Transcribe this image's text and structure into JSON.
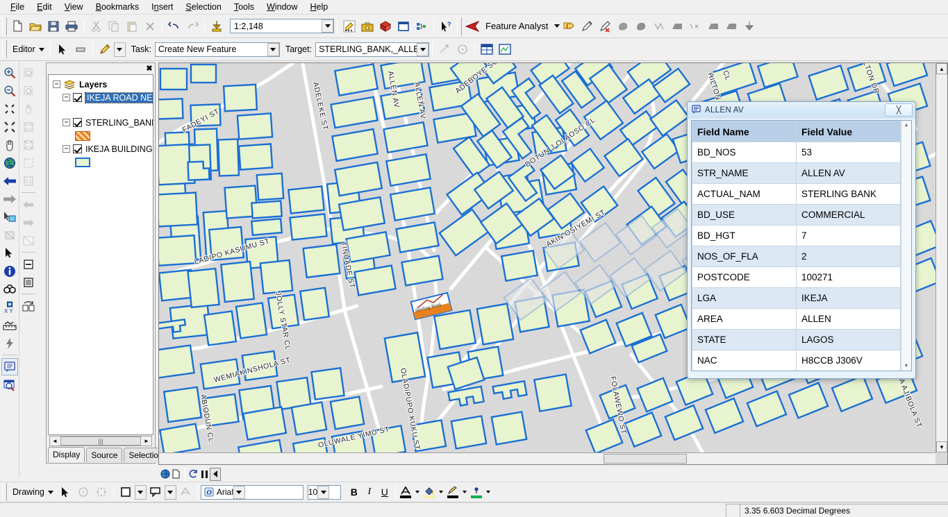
{
  "app": {
    "title": "ArcMap"
  },
  "menu": {
    "items": [
      "File",
      "Edit",
      "View",
      "Bookmarks",
      "Insert",
      "Selection",
      "Tools",
      "Window",
      "Help"
    ]
  },
  "standard_toolbar": {
    "scale": "1:2,148",
    "buttons": [
      "new-icon",
      "open-icon",
      "save-icon",
      "print-icon",
      "cut-icon",
      "copy-icon",
      "paste-icon",
      "delete-icon",
      "undo-icon",
      "redo-icon",
      "add-data-icon"
    ],
    "right_buttons": [
      "editor-toolbar-icon",
      "toolbox-icon",
      "model-builder-icon",
      "command-line-icon",
      "python-icon",
      "whats-this-icon"
    ]
  },
  "feature_analyst": {
    "label": "Feature Analyst",
    "buttons": [
      "learn-icon",
      "draw-icon",
      "erase-icon",
      "polygon-icon",
      "polygon2-icon",
      "vertex-icon",
      "clip-icon",
      "remove-icon",
      "merge-icon",
      "split-icon",
      "down-icon"
    ]
  },
  "editor_toolbar": {
    "editor_label": "Editor",
    "task_label": "Task:",
    "task_value": "Create New Feature",
    "target_label": "Target:",
    "target_value": "STERLING_BANK,_ALLEN_AV",
    "buttons": [
      "edit-tool-icon",
      "edit-sketch-icon",
      "sketch-tool-icon",
      "split-tool-icon",
      "rotate-icon",
      "attributes-icon",
      "sketch-properties-icon"
    ]
  },
  "tools_palette": {
    "col1": [
      "zoom-in-icon",
      "zoom-out-icon",
      "fixed-zoom-in-icon",
      "fixed-zoom-out-icon",
      "pan-icon",
      "full-extent-icon",
      "go-back-icon",
      "go-forward-icon",
      "select-features-icon",
      "clear-selection-icon",
      "select-elements-icon",
      "identify-icon",
      "find-icon",
      "go-to-xy-icon",
      "measure-icon",
      "flash-icon",
      "html-popup-icon",
      "hyperlink-icon"
    ],
    "col2": [
      "zoom-in-layout-icon",
      "zoom-out-layout-icon",
      "pan-layout-icon",
      "fixed-zoom-in-layout-icon",
      "fixed-zoom-out-layout-icon",
      "full-page-icon",
      "one-to-one-icon",
      "back-layout-icon",
      "forward-layout-icon",
      "toggle-draft-icon",
      "focus-data-frame-icon",
      "change-layout-icon",
      "page-rotate-icon"
    ]
  },
  "toc": {
    "close_label": "✖",
    "root": "Layers",
    "layers": [
      {
        "name": "IKEJA ROAD NET",
        "selected": true,
        "checked": true,
        "symbol": null
      },
      {
        "name": "STERLING_BANK,",
        "selected": false,
        "checked": true,
        "symbol": "orange"
      },
      {
        "name": "IKEJA BUILDING F",
        "selected": false,
        "checked": true,
        "symbol": "green"
      }
    ],
    "tabs": [
      {
        "label": "Display",
        "active": true
      },
      {
        "label": "Source",
        "active": false
      },
      {
        "label": "Selection",
        "active": false
      }
    ]
  },
  "map": {
    "background_color": "#d9d9d9",
    "building_fill": "#e7f4cf",
    "building_stroke": "#1a6fd4",
    "road_color": "#ffffff",
    "selected_feature_label": "Sterling Bank",
    "street_labels": [
      "FADEYI ST",
      "ADELEKE ST",
      "LADIPO KASUMU ST",
      "ALLEN AV",
      "ALLEN AV",
      "ADEBOYE SOLANKE AV",
      "DOTUN J OLAOSO CL",
      "AKIN OSIYEMI ST",
      "TINUADE ST",
      "JOLLY STAR CL",
      "WEMIAKINSHOLA ST",
      "ABIODUN CL",
      "OLUWALE YIMU ST",
      "OLADIPUPO KUKU ST",
      "FOLAWEWO ST",
      "OLA AJIBOLA ST",
      "HILTON DR",
      "OR CL"
    ]
  },
  "map_nav": {
    "buttons": [
      "globe-icon",
      "page-icon",
      "refresh-icon",
      "pause-icon",
      "resume-icon"
    ]
  },
  "attributes_dialog": {
    "title": "ALLEN AV",
    "title_icon": "identify-balloon-icon",
    "close_label": "╳",
    "headers": {
      "field": "Field Name",
      "value": "Field Value"
    },
    "rows": [
      {
        "field": "BD_NOS",
        "value": "53"
      },
      {
        "field": "STR_NAME",
        "value": "ALLEN AV"
      },
      {
        "field": "ACTUAL_NAM",
        "value": "STERLING BANK"
      },
      {
        "field": "BD_USE",
        "value": "COMMERCIAL"
      },
      {
        "field": "BD_HGT",
        "value": "7"
      },
      {
        "field": "NOS_OF_FLA",
        "value": "2"
      },
      {
        "field": "POSTCODE",
        "value": "100271"
      },
      {
        "field": "LGA",
        "value": "IKEJA"
      },
      {
        "field": "AREA",
        "value": "ALLEN"
      },
      {
        "field": "STATE",
        "value": "LAGOS"
      },
      {
        "field": "NAC",
        "value": "H8CCB J306V"
      }
    ]
  },
  "drawing_toolbar": {
    "drawing_label": "Drawing",
    "font_value": "Arial",
    "size_value": "10",
    "bold_label": "B",
    "italic_label": "I",
    "underline_label": "U",
    "font_color": "#000000",
    "fill_color": "#f5f0a8",
    "line_color": "#000000",
    "marker_color": "#00b050",
    "buttons": [
      "select-elements-icon",
      "rotate-icon",
      "nudge-icon",
      "new-rectangle-icon",
      "new-callout-icon",
      "auto-label-icon"
    ]
  },
  "status_bar": {
    "coordinates": "3.35  6.603 Decimal Degrees"
  }
}
